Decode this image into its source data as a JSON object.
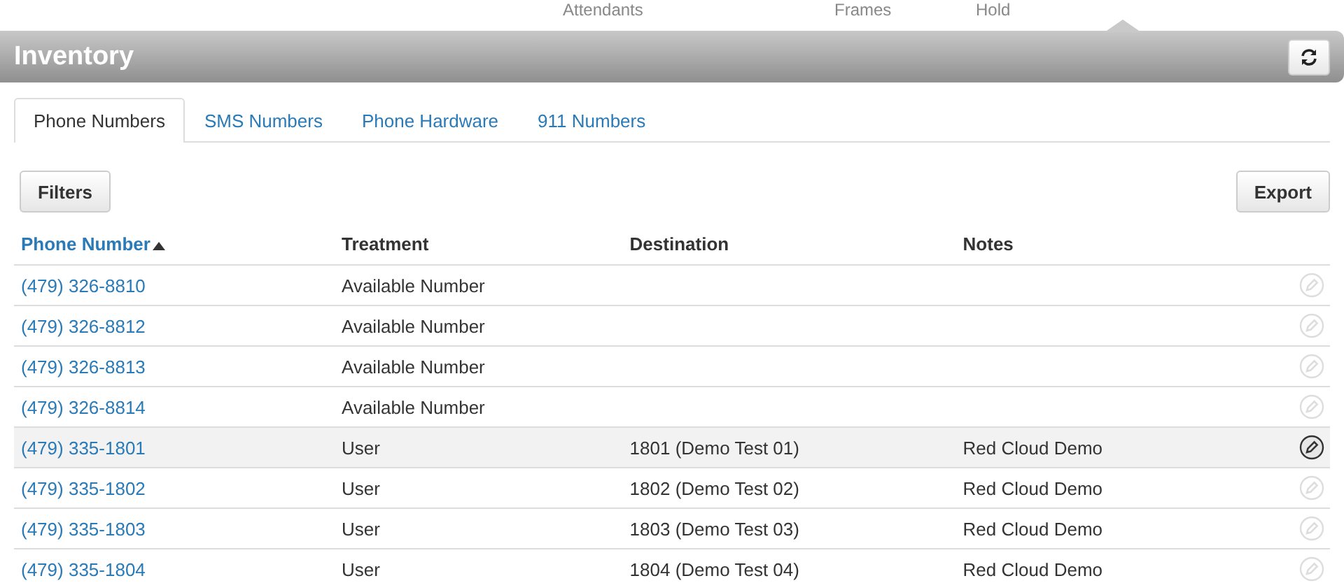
{
  "top_nav": [
    "Attendants",
    "Frames",
    "Hold"
  ],
  "header": {
    "title": "Inventory"
  },
  "tabs": [
    {
      "label": "Phone Numbers",
      "selected": true
    },
    {
      "label": "SMS Numbers",
      "selected": false
    },
    {
      "label": "Phone Hardware",
      "selected": false
    },
    {
      "label": "911 Numbers",
      "selected": false
    }
  ],
  "toolbar": {
    "filters": "Filters",
    "export": "Export"
  },
  "table": {
    "columns": [
      {
        "label": "Phone Number",
        "sorted": true
      },
      {
        "label": "Treatment",
        "sorted": false
      },
      {
        "label": "Destination",
        "sorted": false
      },
      {
        "label": "Notes",
        "sorted": false
      }
    ],
    "rows": [
      {
        "phone": "(479) 326-8810",
        "treatment": "Available Number",
        "highlighted": false
      },
      {
        "phone": "(479) 326-8812",
        "treatment": "Available Number",
        "highlighted": false
      },
      {
        "phone": "(479) 326-8813",
        "treatment": "Available Number",
        "highlighted": false
      },
      {
        "phone": "(479) 326-8814",
        "treatment": "Available Number",
        "highlighted": false
      },
      {
        "phone": "(479) 335-1801",
        "treatment": "User",
        "destination": "1801 (Demo Test 01)",
        "notes": "Red Cloud Demo",
        "highlighted": true
      },
      {
        "phone": "(479) 335-1802",
        "treatment": "User",
        "destination": "1802 (Demo Test 02)",
        "notes": "Red Cloud Demo",
        "highlighted": false
      },
      {
        "phone": "(479) 335-1803",
        "treatment": "User",
        "destination": "1803 (Demo Test 03)",
        "notes": "Red Cloud Demo",
        "highlighted": false
      },
      {
        "phone": "(479) 335-1804",
        "treatment": "User",
        "destination": "1804 (Demo Test 04)",
        "notes": "Red Cloud Demo",
        "highlighted": false
      }
    ]
  }
}
